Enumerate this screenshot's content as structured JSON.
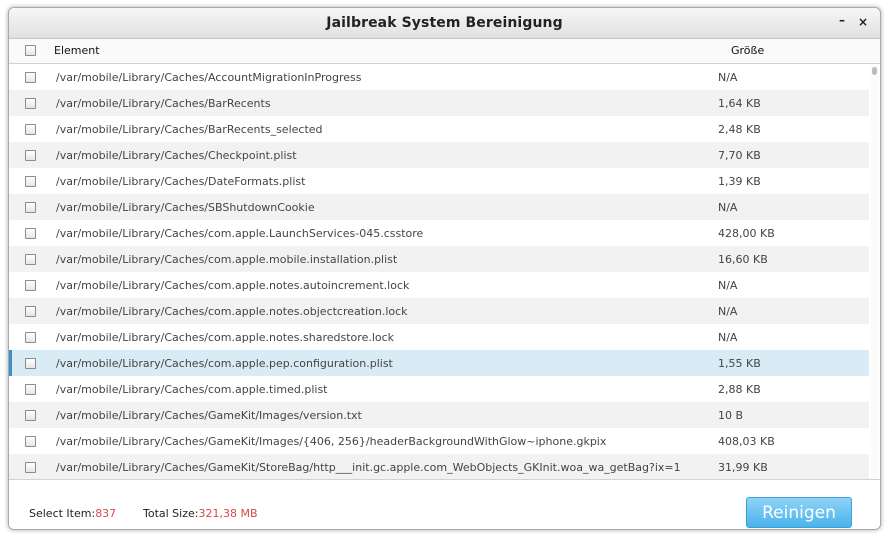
{
  "window": {
    "title": "Jailbreak System Bereinigung",
    "minimize_glyph": "–",
    "close_glyph": "×"
  },
  "table": {
    "col_element": "Element",
    "col_size": "Größe",
    "rows": [
      {
        "path": "/var/mobile/Library/Caches/AccountMigrationInProgress",
        "size": "N/A"
      },
      {
        "path": "/var/mobile/Library/Caches/BarRecents",
        "size": "1,64 KB"
      },
      {
        "path": "/var/mobile/Library/Caches/BarRecents_selected",
        "size": "2,48 KB"
      },
      {
        "path": "/var/mobile/Library/Caches/Checkpoint.plist",
        "size": "7,70 KB"
      },
      {
        "path": "/var/mobile/Library/Caches/DateFormats.plist",
        "size": "1,39 KB"
      },
      {
        "path": "/var/mobile/Library/Caches/SBShutdownCookie",
        "size": "N/A"
      },
      {
        "path": "/var/mobile/Library/Caches/com.apple.LaunchServices-045.csstore",
        "size": "428,00 KB"
      },
      {
        "path": "/var/mobile/Library/Caches/com.apple.mobile.installation.plist",
        "size": "16,60 KB"
      },
      {
        "path": "/var/mobile/Library/Caches/com.apple.notes.autoincrement.lock",
        "size": "N/A"
      },
      {
        "path": "/var/mobile/Library/Caches/com.apple.notes.objectcreation.lock",
        "size": "N/A"
      },
      {
        "path": "/var/mobile/Library/Caches/com.apple.notes.sharedstore.lock",
        "size": "N/A"
      },
      {
        "path": "/var/mobile/Library/Caches/com.apple.pep.configuration.plist",
        "size": "1,55 KB",
        "selected": true
      },
      {
        "path": "/var/mobile/Library/Caches/com.apple.timed.plist",
        "size": "2,88 KB"
      },
      {
        "path": "/var/mobile/Library/Caches/GameKit/Images/version.txt",
        "size": "10 B"
      },
      {
        "path": "/var/mobile/Library/Caches/GameKit/Images/{406, 256}/headerBackgroundWithGlow~iphone.gkpix",
        "size": "408,03 KB"
      },
      {
        "path": "/var/mobile/Library/Caches/GameKit/StoreBag/http___init.gc.apple.com_WebObjects_GKInit.woa_wa_getBag?ix=1",
        "size": "31,99 KB"
      }
    ]
  },
  "footer": {
    "select_label": "Select Item:",
    "select_value": "837",
    "total_label": "Total Size:",
    "total_value": "321,38 MB",
    "button_label": "Reinigen"
  },
  "colors": {
    "accent_red": "#d64a48",
    "selected_row": "#d9ebf4",
    "button_blue": "#4ab3ea"
  }
}
